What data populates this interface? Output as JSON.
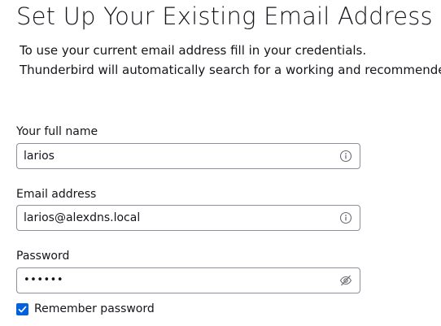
{
  "header": {
    "title": "Set Up Your Existing Email Address",
    "intro_line1": "To use your current email address fill in your credentials.",
    "intro_line2": "Thunderbird will automatically search for a working and recommended"
  },
  "form": {
    "name": {
      "label": "Your full name",
      "value": "larios",
      "icon": "info-icon"
    },
    "email": {
      "label": "Email address",
      "value": "larios@alexdns.local",
      "icon": "info-icon"
    },
    "password": {
      "label": "Password",
      "value": "••••••",
      "icon": "eye-slash-icon"
    },
    "remember": {
      "label": "Remember password",
      "checked": true
    }
  },
  "colors": {
    "accent": "#0061e0",
    "border": "#8f8f9d",
    "text": "#15141a"
  }
}
